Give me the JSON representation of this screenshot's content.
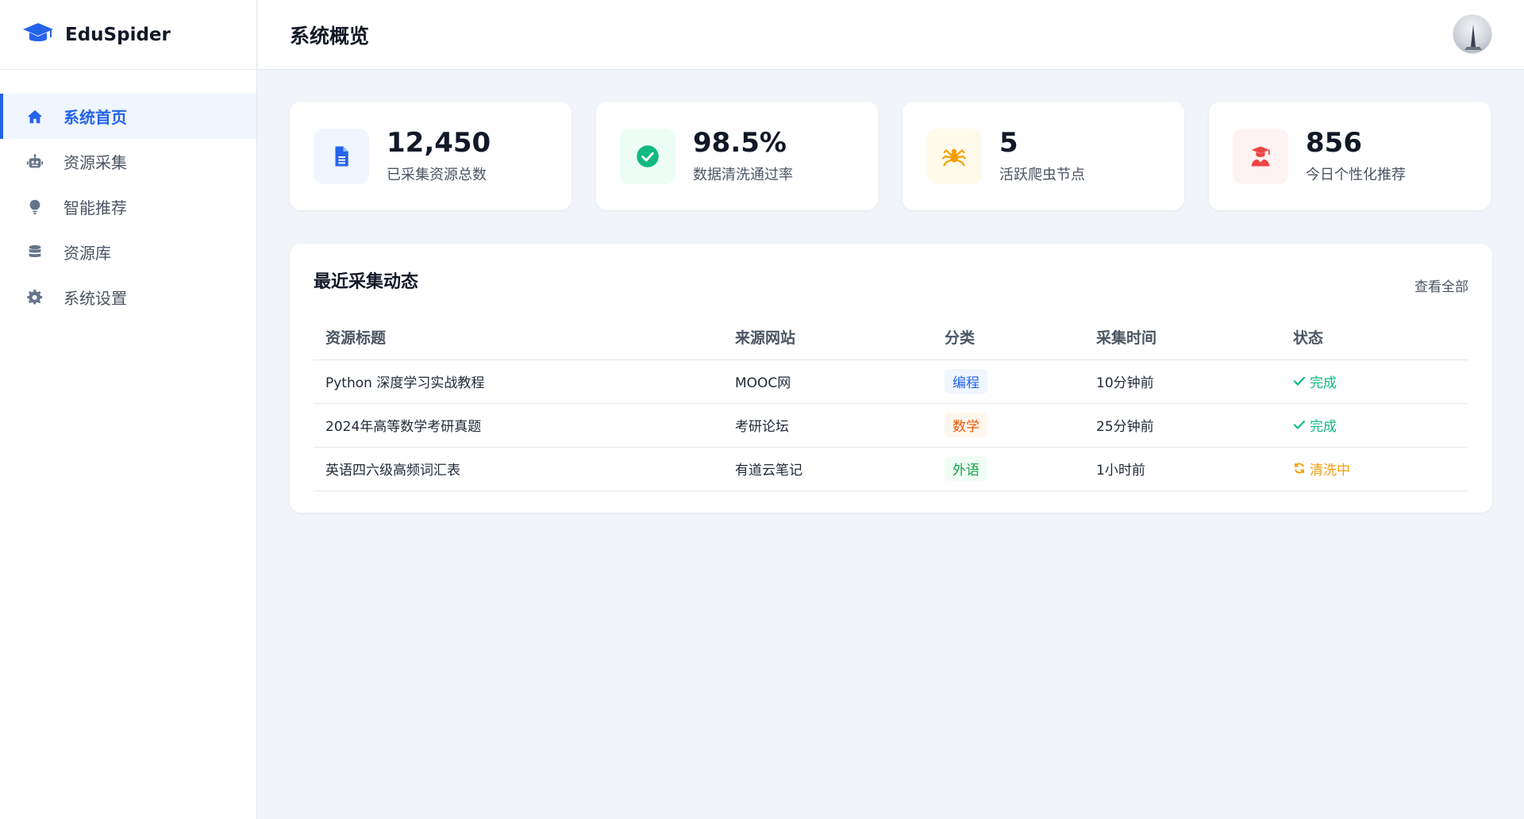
{
  "app": {
    "brand": "EduSpider",
    "logo_icon": "graduation-cap-icon"
  },
  "sidebar": {
    "items": [
      {
        "label": "系统首页",
        "icon": "home-icon",
        "active": true
      },
      {
        "label": "资源采集",
        "icon": "robot-icon",
        "active": false
      },
      {
        "label": "智能推荐",
        "icon": "lightbulb-icon",
        "active": false
      },
      {
        "label": "资源库",
        "icon": "database-icon",
        "active": false
      },
      {
        "label": "系统设置",
        "icon": "gear-icon",
        "active": false
      }
    ]
  },
  "header": {
    "title": "系统概览",
    "avatar_icon": "avatar-icon"
  },
  "stats": [
    {
      "value": "12,450",
      "label": "已采集资源总数",
      "icon": "document-icon",
      "color": "#2563eb",
      "bg": "#eff6ff"
    },
    {
      "value": "98.5%",
      "label": "数据清洗通过率",
      "icon": "check-circle-icon",
      "color": "#10b981",
      "bg": "#ecfdf5"
    },
    {
      "value": "5",
      "label": "活跃爬虫节点",
      "icon": "spider-icon",
      "color": "#f59e0b",
      "bg": "#fffbeb"
    },
    {
      "value": "856",
      "label": "今日个性化推荐",
      "icon": "student-icon",
      "color": "#ef4444",
      "bg": "#fef2f2"
    }
  ],
  "recent": {
    "title": "最近采集动态",
    "view_all": "查看全部",
    "columns": [
      "资源标题",
      "来源网站",
      "分类",
      "采集时间",
      "状态"
    ],
    "rows": [
      {
        "title": "Python 深度学习实战教程",
        "source": "MOOC网",
        "category": "编程",
        "category_color": "#2563eb",
        "category_bg": "#eff6ff",
        "time": "10分钟前",
        "status": "完成",
        "status_color": "#10b981",
        "status_icon": "check-icon"
      },
      {
        "title": "2024年高等数学考研真题",
        "source": "考研论坛",
        "category": "数学",
        "category_color": "#ea580c",
        "category_bg": "#fff7ed",
        "time": "25分钟前",
        "status": "完成",
        "status_color": "#10b981",
        "status_icon": "check-icon"
      },
      {
        "title": "英语四六级高频词汇表",
        "source": "有道云笔记",
        "category": "外语",
        "category_color": "#16a34a",
        "category_bg": "#f0fdf4",
        "time": "1小时前",
        "status": "清洗中",
        "status_color": "#f59e0b",
        "status_icon": "sync-icon"
      }
    ]
  }
}
